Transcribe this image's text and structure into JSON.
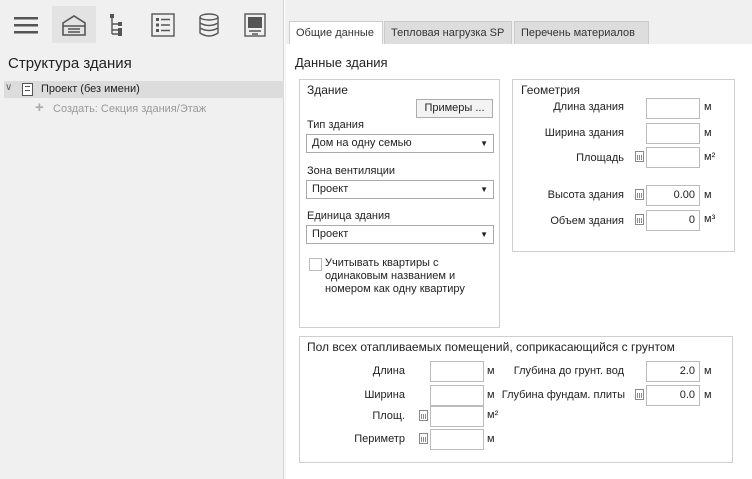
{
  "toolbar": {
    "items": [
      {
        "icon": "menu-icon"
      },
      {
        "icon": "building-icon"
      },
      {
        "icon": "hierarchy-icon"
      },
      {
        "icon": "list-icon"
      },
      {
        "icon": "database-icon"
      },
      {
        "icon": "monitor-icon"
      }
    ]
  },
  "tree": {
    "title": "Структура здания",
    "project_label": "Проект (без имени)",
    "create_label": "Создать: Секция здания/Этаж"
  },
  "tabs": [
    {
      "label": "Общие данные"
    },
    {
      "label": "Тепловая нагрузка SP"
    },
    {
      "label": "Перечень материалов"
    }
  ],
  "section_title": "Данные здания",
  "building": {
    "title": "Здание",
    "examples_button": "Примеры ...",
    "type_label": "Тип здания",
    "type_value": "Дом на одну семью",
    "vent_label": "Зона вентиляции",
    "vent_value": "Проект",
    "unit_label": "Единица здания",
    "unit_value": "Проект",
    "checkbox_label": "Учитывать квартиры с одинаковым названием и номером как одну квартиру"
  },
  "geometry": {
    "title": "Геометрия",
    "length_label": "Длина здания",
    "length_value": "",
    "length_unit": "м",
    "width_label": "Ширина здания",
    "width_value": "",
    "width_unit": "м",
    "area_label": "Площадь",
    "area_value": "",
    "area_unit": "м²",
    "height_label": "Высота здания",
    "height_value": "0.00",
    "height_unit": "м",
    "volume_label": "Объем здания",
    "volume_value": "0",
    "volume_unit": "м³"
  },
  "floor": {
    "title": "Пол всех отапливаемых помещений, соприкасающийся с грунтом",
    "length_label": "Длина",
    "length_value": "",
    "length_unit": "м",
    "width_label": "Ширина",
    "width_value": "",
    "width_unit": "м",
    "area_label": "Площ.",
    "area_value": "",
    "area_unit": "м²",
    "perim_label": "Периметр",
    "perim_value": "",
    "perim_unit": "м",
    "gw_label": "Глубина до грунт. вод",
    "gw_value": "2.0",
    "gw_unit": "м",
    "slab_label": "Глубина фундам. плиты",
    "slab_value": "0.0",
    "slab_unit": "м"
  }
}
